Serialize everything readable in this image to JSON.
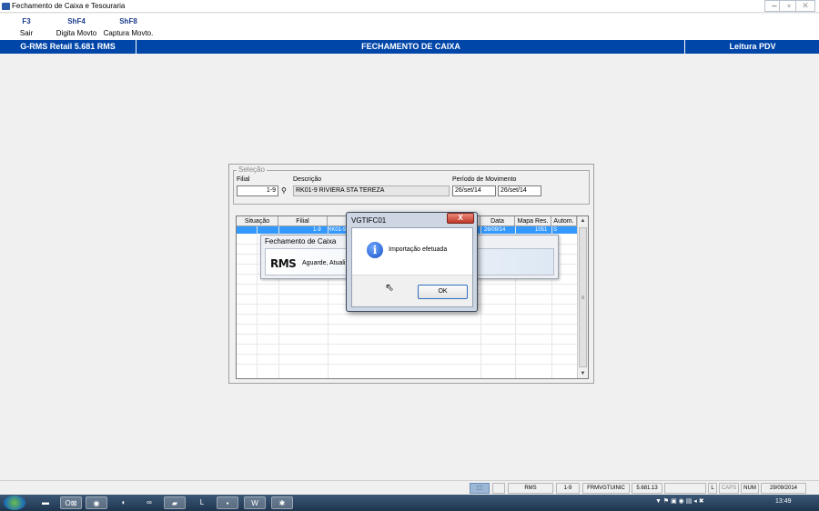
{
  "window": {
    "title": "Fechamento de Caixa e Tesouraria",
    "minimize": "–",
    "maximize": "▫",
    "close": "✕"
  },
  "fkeys": [
    {
      "key": "F3",
      "label": "Sair"
    },
    {
      "key": "ShF4",
      "label": "Digita Movto"
    },
    {
      "key": "ShF8",
      "label": "Captura Movto."
    }
  ],
  "header": {
    "left": "G-RMS Retail 5.681 RMS",
    "center": "FECHAMENTO DE CAIXA",
    "right": "Leitura PDV"
  },
  "selecao": {
    "legend": "Seleção",
    "filial_label": "Filial",
    "filial_value": "1-9",
    "descricao_label": "Descrição",
    "descricao_value": "RK01-9 RIVIERA STA TEREZA",
    "periodo_label": "Período de Movimento",
    "periodo_inicio": "26/set/14",
    "periodo_fim": "26/set/14"
  },
  "grid": {
    "columns": [
      "Situação",
      "Filial",
      "Data",
      "Mapa Res.",
      "Autom."
    ],
    "row": {
      "filial": "1-9",
      "descricao": "RK01-9 R",
      "data": "26/09/14",
      "mapa": "1051",
      "autom": "S"
    },
    "scroll_up": "▲",
    "scroll_down": "▼",
    "scroll_thumb": "≡"
  },
  "popup": {
    "title": "Fechamento de Caixa",
    "logo": "RMS",
    "message": "Aguarde, Atuali"
  },
  "dialog": {
    "title": "VGTIFC01",
    "close": "X",
    "icon": "info-icon",
    "message": "Importação efetuada",
    "ok": "OK"
  },
  "statusbar": {
    "icon_text": "⬚",
    "user": "RMS",
    "filial": "1-9",
    "program": "FRMVGTUINIC",
    "version": "5.681.13",
    "blank": "",
    "l": "L",
    "caps": "CAPS",
    "num": "NUM",
    "date": "29/09/2014"
  },
  "taskbar": {
    "items": [
      "▬",
      "O⊠",
      "◉",
      "◐",
      "∞",
      "▰",
      "L",
      "▪",
      "W",
      "✱"
    ],
    "tray": "▼ ⚑ ▣ ◉ ▤ ◂ ✖",
    "clock": "13:49"
  }
}
